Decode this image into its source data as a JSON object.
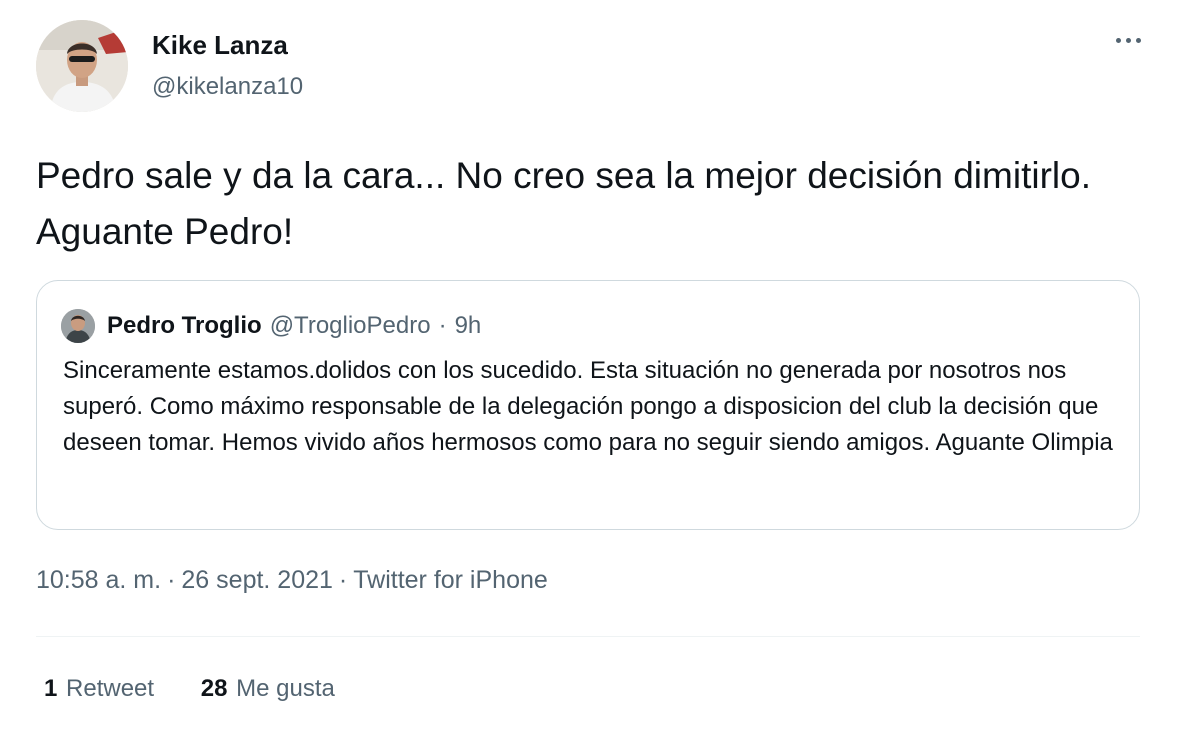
{
  "author": {
    "name": "Kike Lanza",
    "handle": "@kikelanza10"
  },
  "tweet": {
    "text": "Pedro sale y da la cara... No creo sea la mejor decisión dimitirlo. Aguante Pedro!"
  },
  "quoted_tweet": {
    "name": "Pedro Troglio",
    "handle": "@TroglioPedro",
    "separator": "·",
    "time": "9h",
    "text": "Sinceramente estamos.dolidos con los sucedido. Esta situación no generada por nosotros nos superó. Como máximo responsable de la delegación pongo a disposicion del club la decisión que deseen tomar. Hemos vivido años hermosos como para no seguir siendo amigos. Aguante Olimpia"
  },
  "meta": {
    "time": "10:58 a. m.",
    "date": "26 sept. 2021",
    "source": "Twitter for iPhone",
    "separator": "·"
  },
  "stats": {
    "retweets_count": "1",
    "retweets_label": "Retweet",
    "likes_count": "28",
    "likes_label": "Me gusta"
  },
  "icons": {
    "more": "more-horizontal-icon"
  },
  "colors": {
    "text_primary": "#0f1419",
    "text_secondary": "#536471",
    "border": "#cfd9de"
  }
}
